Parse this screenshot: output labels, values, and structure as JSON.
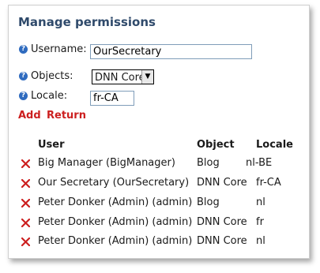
{
  "title": "Manage permissions",
  "form": {
    "username_label": "Username:",
    "username_value": "OurSecretary",
    "objects_label": "Objects:",
    "objects_selected": "DNN Core",
    "locale_label": "Locale:",
    "locale_value": "fr-CA"
  },
  "actions": {
    "add": "Add",
    "return": "Return"
  },
  "table": {
    "headers": [
      "User",
      "Object",
      "Locale"
    ],
    "rows": [
      {
        "user": "Big Manager (BigManager)",
        "object": "Blog",
        "locale": "nl-BE"
      },
      {
        "user": "Our Secretary (OurSecretary)",
        "object": "DNN Core",
        "locale": "fr-CA"
      },
      {
        "user": "Peter Donker (Admin) (admin)",
        "object": "Blog",
        "locale": "nl"
      },
      {
        "user": "Peter Donker (Admin) (admin)",
        "object": "DNN Core",
        "locale": "fr"
      },
      {
        "user": "Peter Donker (Admin) (admin)",
        "object": "DNN Core",
        "locale": "nl"
      }
    ]
  },
  "colors": {
    "title": "#2f4a6b",
    "action": "#cc1f1f",
    "help_icon": "#2f6bbf",
    "delete_icon": "#cc1f1f"
  }
}
